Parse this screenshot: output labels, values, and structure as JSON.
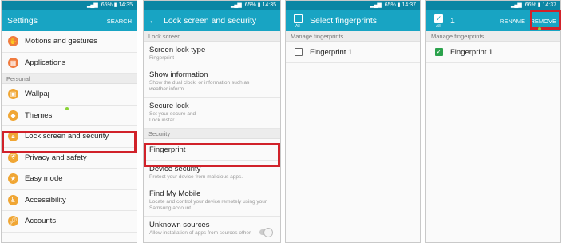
{
  "status_bars": [
    {
      "battery": "65%",
      "time": "14:35"
    },
    {
      "battery": "65%",
      "time": "14:35"
    },
    {
      "battery": "65%",
      "time": "14:37"
    },
    {
      "battery": "66%",
      "time": "14:37"
    }
  ],
  "screen1": {
    "title": "Settings",
    "action": "SEARCH",
    "items_top": [
      {
        "label": "Motions and gestures",
        "icon": "gesture-icon",
        "color": "#f07b3f"
      },
      {
        "label": "Applications",
        "icon": "applications-icon",
        "color": "#f07b3f"
      }
    ],
    "section": "Personal",
    "items": [
      {
        "label": "Wallpaper",
        "icon": "wallpaper-icon",
        "color": "#f0a634"
      },
      {
        "label": "Themes",
        "icon": "themes-icon",
        "color": "#f0a634"
      },
      {
        "label": "Lock screen and security",
        "icon": "lock-icon",
        "color": "#f0a634"
      },
      {
        "label": "Privacy and safety",
        "icon": "privacy-icon",
        "color": "#f0a634"
      },
      {
        "label": "Easy mode",
        "icon": "easy-mode-icon",
        "color": "#f0a634"
      },
      {
        "label": "Accessibility",
        "icon": "accessibility-icon",
        "color": "#f0a634"
      },
      {
        "label": "Accounts",
        "icon": "accounts-icon",
        "color": "#f0a634"
      }
    ]
  },
  "screen2": {
    "title": "Lock screen and security",
    "section1": "Lock screen",
    "items1": [
      {
        "title": "Screen lock type",
        "sub": "Fingerprint"
      },
      {
        "title": "Show information",
        "sub": "Show the dual clock, or information such as weather inform"
      },
      {
        "title": "Secure lock",
        "sub": "Set your secure and Lock instar"
      }
    ],
    "section2": "Security",
    "items2": [
      {
        "title": "Fingerprint",
        "sub": ""
      },
      {
        "title": "Device security",
        "sub": "Protect your device from malicious apps."
      },
      {
        "title": "Find My Mobile",
        "sub": "Locate and control your device remotely using your Samsung account."
      },
      {
        "title": "Unknown sources",
        "sub": "Allow installation of apps from sources other"
      }
    ]
  },
  "screen3": {
    "title": "Select fingerprints",
    "all_label": "All",
    "section": "Manage fingerprints",
    "item": "Fingerprint 1"
  },
  "screen4": {
    "count": "1",
    "all_label": "All",
    "rename": "RENAME",
    "remove": "REMOVE",
    "section": "Manage fingerprints",
    "item": "Fingerprint 1"
  },
  "colors": {
    "appbar": "#18a4c3",
    "status": "#0b86a4",
    "highlight": "#d1222a",
    "check": "#2ba24c"
  }
}
